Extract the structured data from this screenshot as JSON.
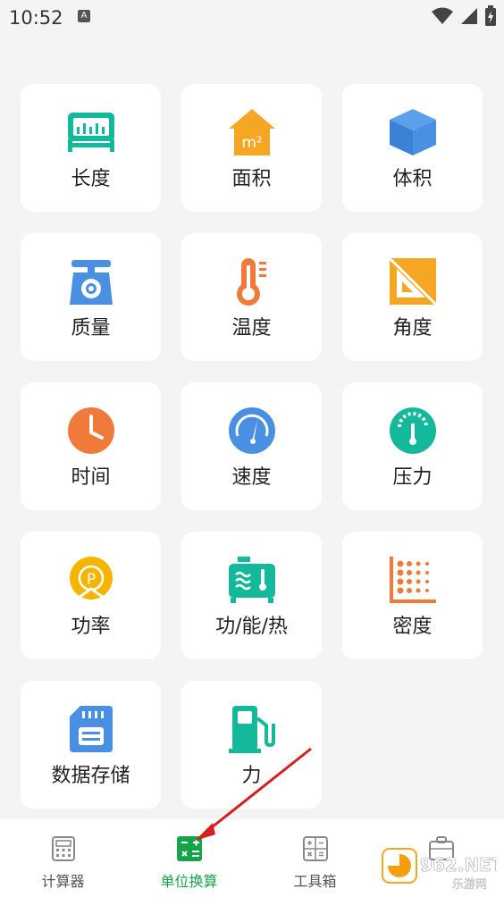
{
  "status": {
    "time": "10:52",
    "notice_letter": "A"
  },
  "grid": {
    "items": [
      {
        "label": "长度"
      },
      {
        "label": "面积",
        "icon_text": "m²"
      },
      {
        "label": "体积"
      },
      {
        "label": "质量"
      },
      {
        "label": "温度"
      },
      {
        "label": "角度"
      },
      {
        "label": "时间"
      },
      {
        "label": "速度"
      },
      {
        "label": "压力"
      },
      {
        "label": "功率",
        "icon_text": "P"
      },
      {
        "label": "功/能/热"
      },
      {
        "label": "密度"
      },
      {
        "label": "数据存储"
      },
      {
        "label": "力"
      }
    ]
  },
  "tabbar": {
    "tabs": [
      {
        "label": "计算器"
      },
      {
        "label": "单位换算"
      },
      {
        "label": "工具箱"
      },
      {
        "label": ""
      }
    ]
  },
  "watermark": {
    "main": "962.NET",
    "sub": "乐游网"
  },
  "colors": {
    "accent": "#16a34a",
    "teal": "#14b89a",
    "orange": "#f07a3a",
    "amber": "#f5a623",
    "blue": "#4a90e2",
    "arrow": "#d61f1f"
  }
}
